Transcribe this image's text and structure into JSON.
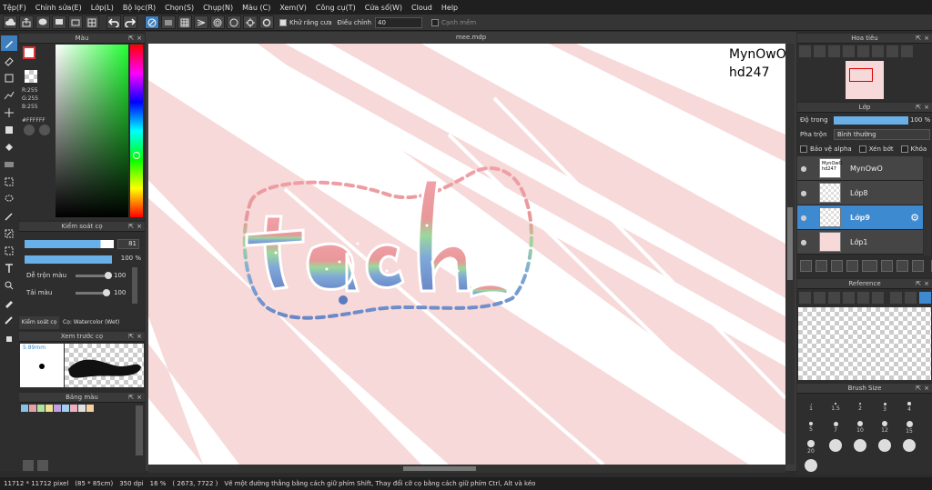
{
  "menu": [
    "Tệp(F)",
    "Chỉnh sửa(E)",
    "Lớp(L)",
    "Bộ lọc(R)",
    "Chọn(S)",
    "Chụp(N)",
    "Màu (C)",
    "Xem(V)",
    "Công cụ(T)",
    "Cửa sổ(W)",
    "Cloud",
    "Help"
  ],
  "toolbar": {
    "antialias_label": "Khử răng cưa",
    "adjust_label": "Điều chỉnh",
    "adjust_value": "40",
    "edge_label": "Cạnh mềm"
  },
  "color_panel": {
    "title": "Màu",
    "r": "R:255",
    "g": "G:255",
    "b": "B:255",
    "hex": "#FFFFFF"
  },
  "brush_control": {
    "title": "Kiểm soát cọ",
    "size_value": "81",
    "opacity_value": "100 %",
    "mix_label": "Dễ trộn màu",
    "mix_value": "100",
    "load_label": "Tải màu",
    "load_value": "100",
    "tab_label": "Kiểm soát cọ",
    "brush_name": "Cọ: Watercolor (Wet)"
  },
  "brush_preview": {
    "title": "Xem trước cọ",
    "size_label": "5.89mm"
  },
  "palette": {
    "title": "Bảng màu",
    "colors": [
      "#88c0e8",
      "#e8a0a8",
      "#b0e0a0",
      "#f0e090",
      "#c0a0e0",
      "#a0d0f0",
      "#f0b0c0",
      "#e0e0e0",
      "#f8d0a0"
    ]
  },
  "canvas": {
    "tab": "mee.mdp",
    "watermark_line1": "MynOwO",
    "watermark_line2": "hd247"
  },
  "navigator": {
    "title": "Hoa tiêu"
  },
  "layers": {
    "title": "Lớp",
    "opacity_label": "Độ trong",
    "opacity_value": "100 %",
    "blend_label": "Pha trộn",
    "blend_value": "Bình thường",
    "protect_alpha": "Bảo vệ alpha",
    "clipping": "Xén bớt",
    "lock": "Khóa",
    "items": [
      {
        "name": "MynOwO",
        "thumb_text": "MynOwO hd247"
      },
      {
        "name": "Lớp8"
      },
      {
        "name": "Lớp9"
      },
      {
        "name": "Lớp1"
      }
    ]
  },
  "reference": {
    "title": "Reference"
  },
  "brush_size": {
    "title": "Brush Size",
    "sizes": [
      "1",
      "1.5",
      "2",
      "3",
      "4",
      "5",
      "7",
      "10",
      "12",
      "15",
      "20",
      "",
      "",
      "",
      "",
      ""
    ]
  },
  "status": {
    "dimensions": "11712 * 11712 pixel",
    "physical": "(85 * 85cm)",
    "dpi": "350 dpi",
    "zoom": "16 %",
    "coords": "( 2673, 7722 )",
    "hint": "Vẽ một đường thẳng bằng cách giữ phím Shift, Thay đổi cỡ cọ bằng cách giữ phím Ctrl, Alt và kéo"
  },
  "colors": {
    "accent": "#3d8ad0",
    "panel": "#2e2e2e",
    "canvas_pink": "#f6d6d6"
  }
}
